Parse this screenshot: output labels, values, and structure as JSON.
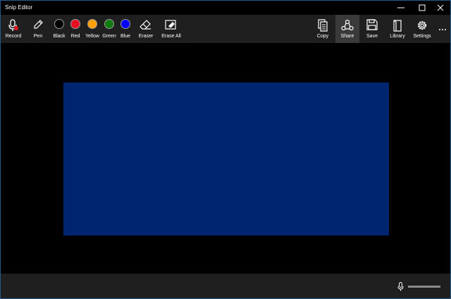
{
  "window": {
    "title": "Snip Editor"
  },
  "toolbar": {
    "record": "Record",
    "pen": "Pen",
    "colors": [
      {
        "label": "Black",
        "color": "#000000"
      },
      {
        "label": "Red",
        "color": "#e81123"
      },
      {
        "label": "Yellow",
        "color": "#ffa000"
      },
      {
        "label": "Green",
        "color": "#107c10"
      },
      {
        "label": "Blue",
        "color": "#0000ff"
      }
    ],
    "eraser": "Eraser",
    "erase_all": "Erase All",
    "copy": "Copy",
    "share": "Share",
    "save": "Save",
    "library": "Library",
    "settings": "Settings"
  },
  "canvas": {
    "image_color": "#002570",
    "background": "#000000"
  },
  "colors": {
    "toolbar_bg": "#1f1f1f",
    "active_bg": "#3a3a3a",
    "window_border": "#2a5a8a"
  }
}
